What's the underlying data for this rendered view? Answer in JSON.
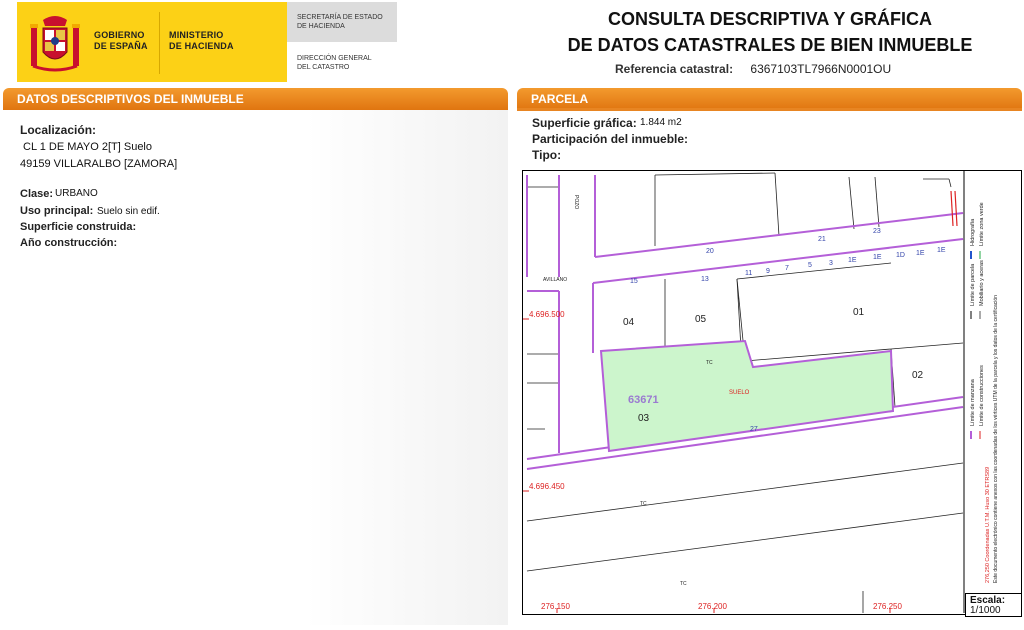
{
  "header": {
    "gov_line1": "GOBIERNO",
    "gov_line2": "DE ESPAÑA",
    "ministry_line1": "MINISTERIO",
    "ministry_line2": "DE HACIENDA",
    "secretaria_line1": "SECRETARÍA DE ESTADO",
    "secretaria_line2": "DE HACIENDA",
    "direccion_line1": "DIRECCIÓN GENERAL",
    "direccion_line2": "DEL CATASTRO",
    "title_line1": "CONSULTA DESCRIPTIVA Y GRÁFICA",
    "title_line2": "DE DATOS CATASTRALES DE BIEN INMUEBLE",
    "ref_label": "Referencia catastral:",
    "ref_value": "6367103TL7966N0001OU",
    "brand_yellow": "#fcd116",
    "accent_orange": "#e88522"
  },
  "left": {
    "section_title": "DATOS DESCRIPTIVOS DEL INMUEBLE",
    "localizacion_label": "Localización:",
    "address_line1": "CL 1 DE MAYO 2[T] Suelo",
    "address_line2": "49159 VILLARALBO [ZAMORA]",
    "clase_label": "Clase:",
    "clase_value": "URBANO",
    "uso_label": "Uso principal:",
    "uso_value": "Suelo sin edif.",
    "superficie_label": "Superficie construida:",
    "ano_label": "Año construcción:"
  },
  "right": {
    "section_title": "PARCELA",
    "sup_grafica_label": "Superficie gráfica:",
    "sup_grafica_value": "1.844 m2",
    "participacion_label": "Participación del inmueble:",
    "tipo_label": "Tipo:"
  },
  "map": {
    "parcel_fill": "#ccf5cc",
    "line_color": "#b45fd8",
    "parcel_labels": [
      "04",
      "05",
      "01",
      "02",
      "03"
    ],
    "parcel_ref": "63671",
    "suelo_label": "SUELO",
    "tc_label": "TC",
    "street_numbers": [
      "20",
      "21",
      "23",
      "15",
      "13",
      "11",
      "9",
      "7",
      "5",
      "3",
      "1E",
      "1E",
      "1D",
      "1E",
      "1E",
      "27"
    ],
    "y_coords": [
      "4.696.500",
      "4.696.450"
    ],
    "x_coords": [
      "276.150",
      "276.200",
      "276.250"
    ],
    "street_name_1": "POZO",
    "street_name_2": "AVILLANO",
    "legend": {
      "manzana": "Límite de manzana",
      "parcela": "Límite de parcela",
      "construcciones": "Límite de construcciones",
      "mobiliario": "Mobiliario y aceras",
      "zona_verde": "Límite zona verde",
      "hidrografia": "Hidrografía",
      "coords_note": "276,250 Coordenadas U.T.M. Huso 30 ETRS89",
      "doc_note": "Este documento electrónico contiene anexos con las coordenadas de los vértices UTM de la parcela y los datos de la certificación"
    },
    "escala_label": "Escala:",
    "escala_value": "1/1000"
  }
}
